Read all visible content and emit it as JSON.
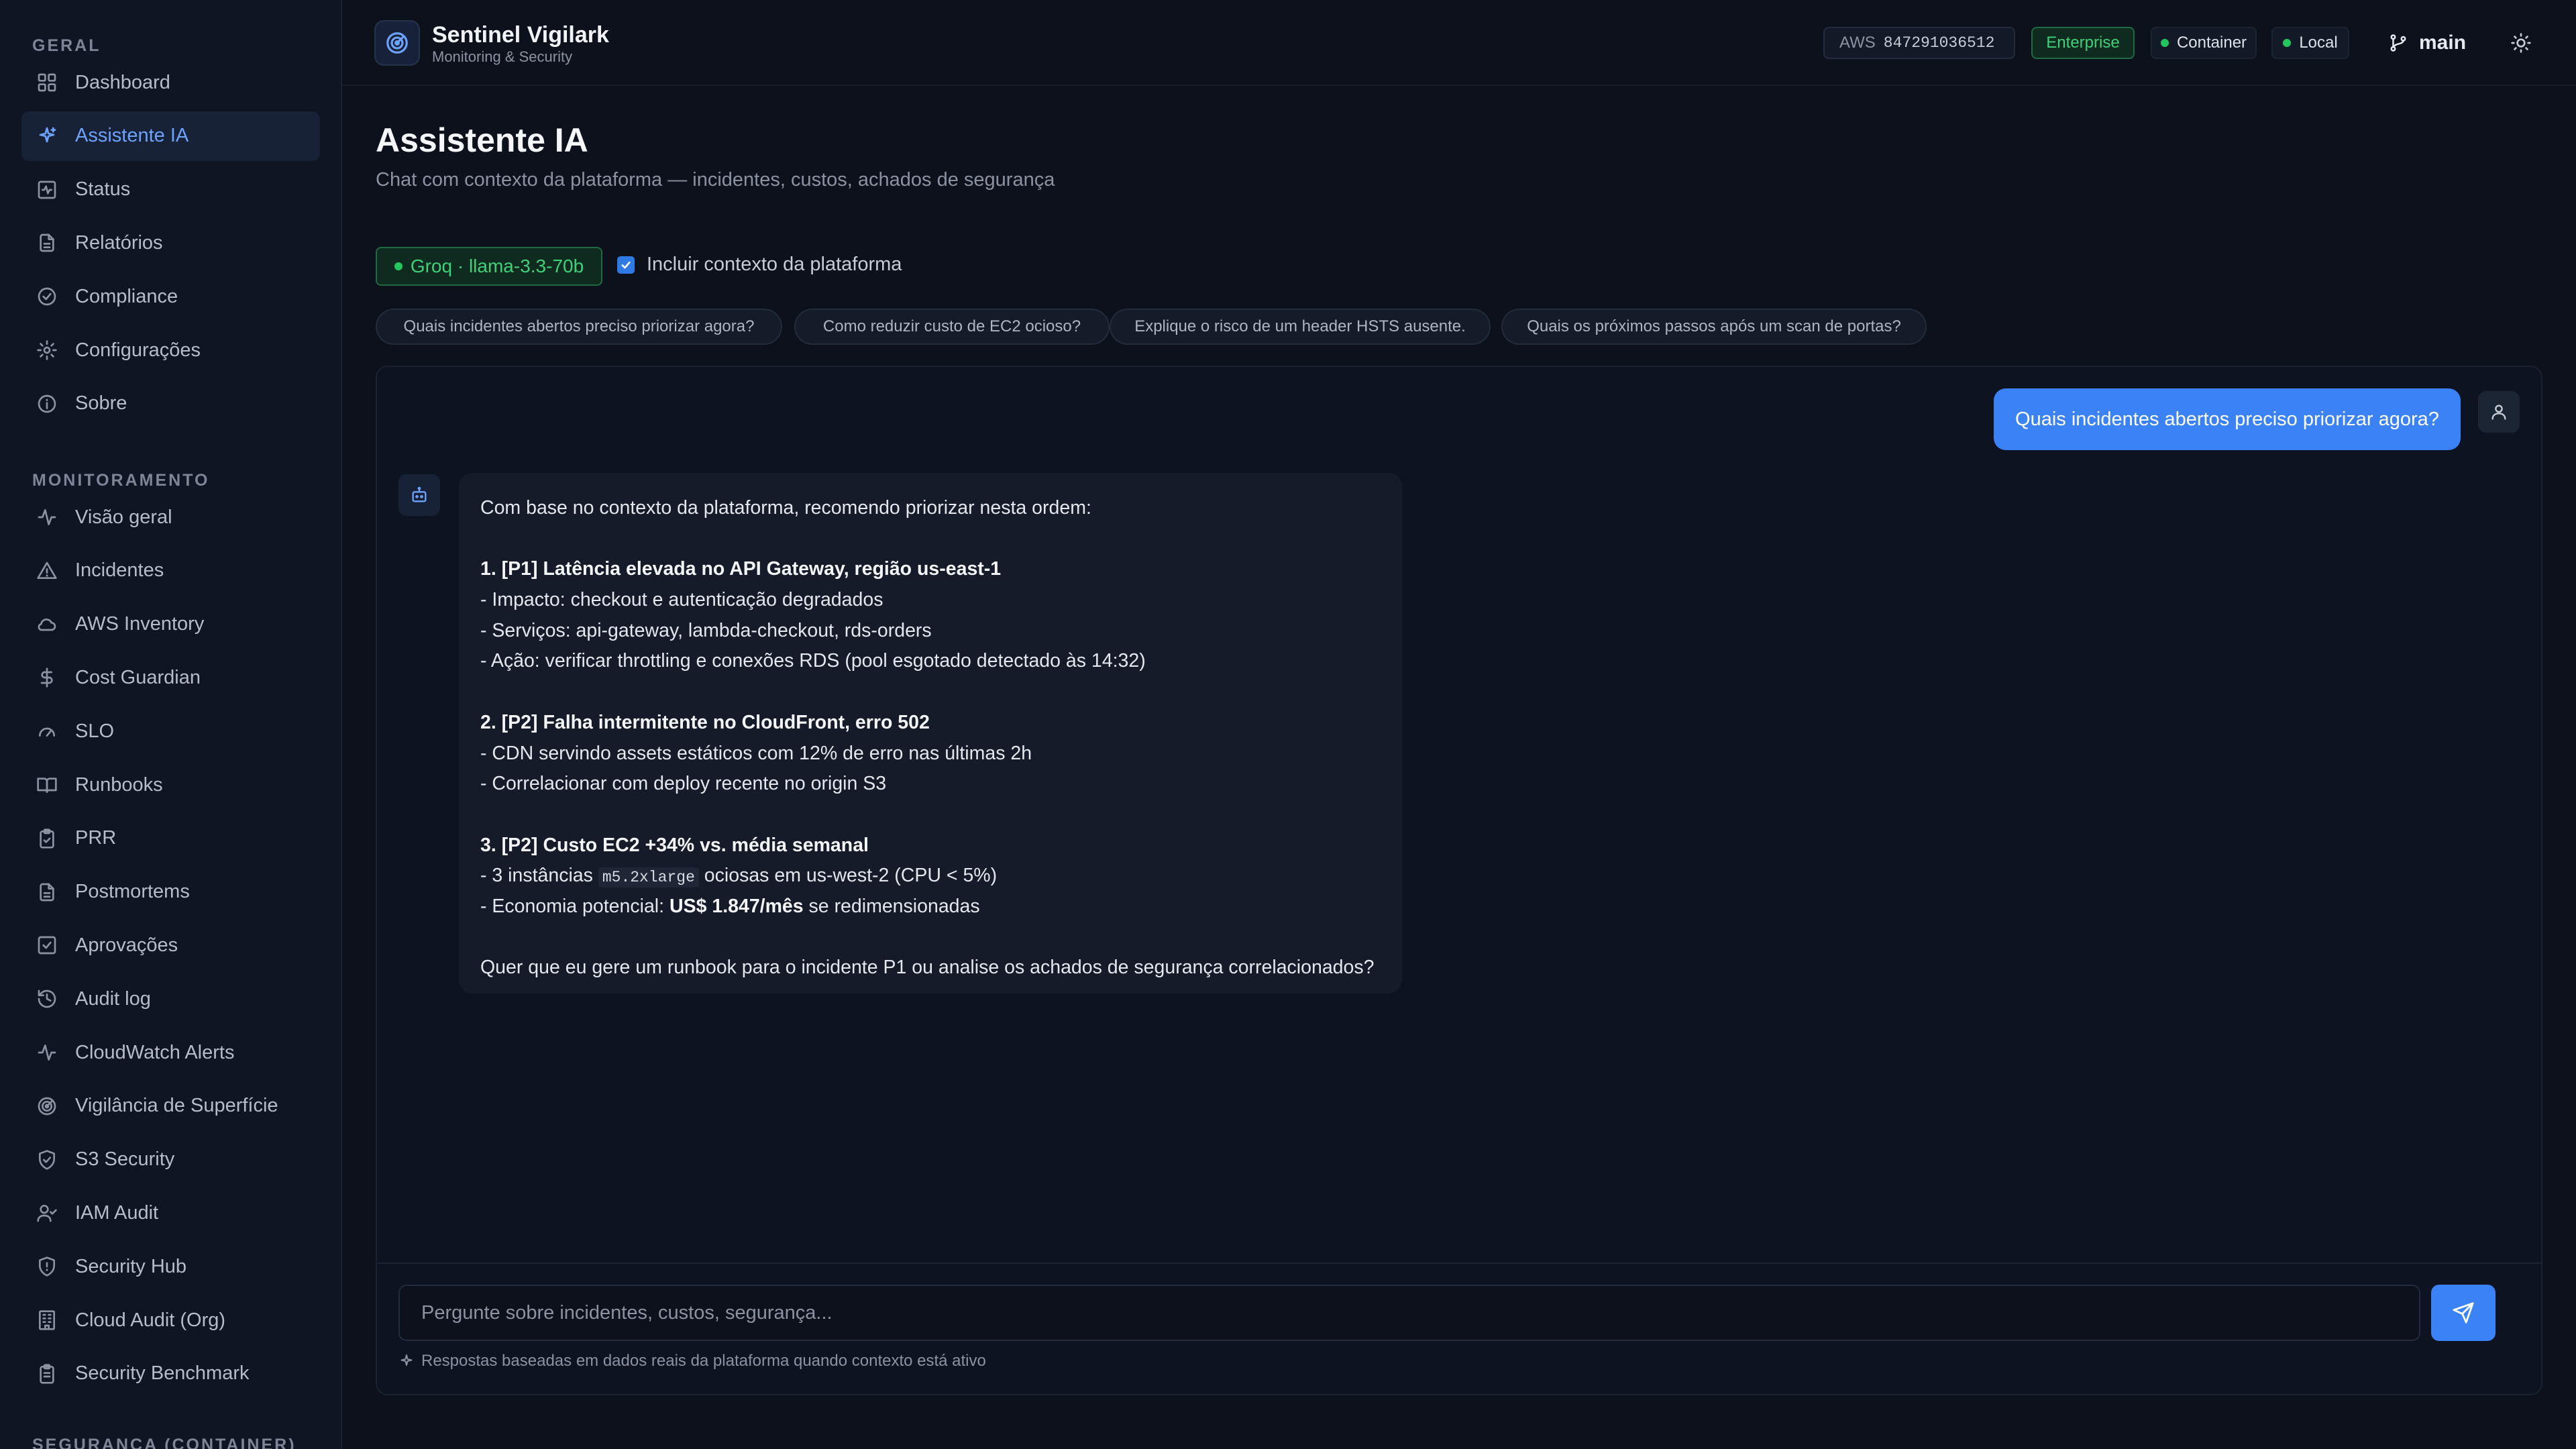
{
  "sidebar": {
    "sections": [
      {
        "label": "GERAL",
        "items": [
          {
            "label": "Dashboard",
            "icon": "layout-grid-icon"
          },
          {
            "label": "Assistente IA",
            "icon": "sparkles-icon",
            "active": true
          },
          {
            "label": "Status",
            "icon": "activity-square-icon"
          },
          {
            "label": "Relatórios",
            "icon": "file-text-icon"
          },
          {
            "label": "Compliance",
            "icon": "check-circle-icon"
          },
          {
            "label": "Configurações",
            "icon": "gear-icon"
          },
          {
            "label": "Sobre",
            "icon": "info-icon"
          }
        ]
      },
      {
        "label": "MONITORAMENTO",
        "items": [
          {
            "label": "Visão geral",
            "icon": "pulse-icon"
          },
          {
            "label": "Incidentes",
            "icon": "warning-triangle-icon"
          },
          {
            "label": "AWS Inventory",
            "icon": "cloud-icon"
          },
          {
            "label": "Cost Guardian",
            "icon": "dollar-icon"
          },
          {
            "label": "SLO",
            "icon": "gauge-icon"
          },
          {
            "label": "Runbooks",
            "icon": "book-open-icon"
          },
          {
            "label": "PRR",
            "icon": "clipboard-check-icon"
          },
          {
            "label": "Postmortems",
            "icon": "file-text-icon"
          },
          {
            "label": "Aprovações",
            "icon": "check-square-icon"
          },
          {
            "label": "Audit log",
            "icon": "history-icon"
          },
          {
            "label": "CloudWatch Alerts",
            "icon": "pulse-icon"
          },
          {
            "label": "Vigilância de Superfície",
            "icon": "radar-icon"
          },
          {
            "label": "S3 Security",
            "icon": "shield-check-icon"
          },
          {
            "label": "IAM Audit",
            "icon": "user-check-icon"
          },
          {
            "label": "Security Hub",
            "icon": "shield-alert-icon"
          },
          {
            "label": "Cloud Audit (Org)",
            "icon": "building-icon"
          },
          {
            "label": "Security Benchmark",
            "icon": "clipboard-list-icon"
          }
        ]
      },
      {
        "label": "SEGURANÇA (CONTAINER)",
        "items": []
      }
    ]
  },
  "header": {
    "title": "Sentinel Vigilark",
    "subtitle": "Monitoring & Security",
    "aws_label": "AWS",
    "aws_account": "847291036512",
    "plan_badge": "Enterprise",
    "env_container": "Container",
    "env_local": "Local",
    "branch": "main",
    "theme_icon": "sun-icon",
    "status_color": "#22c55e",
    "accent_color": "#3b82f6"
  },
  "page": {
    "title": "Assistente IA",
    "subtitle": "Chat com contexto da plataforma — incidentes, custos, achados de segurança",
    "model_badge": "Groq · llama-3.3-70b",
    "context_label": "Incluir contexto da plataforma",
    "context_checked": true,
    "suggestions": [
      "Quais incidentes abertos preciso priorizar agora?",
      "Como reduzir custo de EC2 ocioso?",
      "Explique o risco de um header HSTS ausente.",
      "Quais os próximos passos após um scan de portas?"
    ]
  },
  "chat": {
    "user_message": "Quais incidentes abertos preciso priorizar agora?",
    "assistant": {
      "intro": "Com base no contexto da plataforma, recomendo priorizar nesta ordem:",
      "item1_title": "1. [P1] Latência elevada no API Gateway, região us-east-1",
      "item1_l1": "- Impacto: checkout e autenticação degradados",
      "item1_l2": "- Serviços: api-gateway, lambda-checkout, rds-orders",
      "item1_l3": "- Ação: verificar throttling e conexões RDS (pool esgotado detectado às 14:32)",
      "item2_title": "2. [P2] Falha intermitente no CloudFront, erro 502",
      "item2_l1": "- CDN servindo assets estáticos com 12% de erro nas últimas 2h",
      "item2_l2": "- Correlacionar com deploy recente no origin S3",
      "item3_title": "3. [P2] Custo EC2 +34% vs. média semanal",
      "item3_l1_pre": "- 3 instâncias",
      "item3_l1_code": "m5.2xlarge",
      "item3_l1_post": "ociosas em us-west-2 (CPU < 5%)",
      "item3_l2_pre": "- Economia potencial:",
      "item3_l2_bold": "US$ 1.847/mês",
      "item3_l2_post": "se redimensionadas",
      "closing": "Quer que eu gere um runbook para o incidente P1 ou analise os achados de segurança correlacionados?"
    },
    "input_placeholder": "Pergunte sobre incidentes, custos, segurança...",
    "footnote": "Respostas baseadas em dados reais da plataforma quando contexto está ativo"
  }
}
